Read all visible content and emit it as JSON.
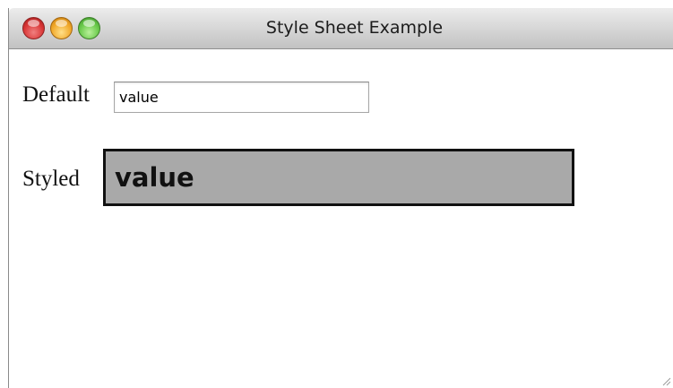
{
  "window": {
    "title": "Style Sheet Example"
  },
  "form": {
    "default_label": "Default",
    "default_value": "value",
    "styled_label": "Styled",
    "styled_value": "value"
  },
  "icons": {
    "close": "close-icon",
    "minimize": "minimize-icon",
    "zoom": "zoom-icon",
    "resize": "resize-grip-icon"
  },
  "colors": {
    "styled_field_background": "#a9a9a9",
    "styled_field_border": "#111111",
    "close": "#d93636",
    "minimize": "#f1a82a",
    "zoom": "#69c94a"
  }
}
